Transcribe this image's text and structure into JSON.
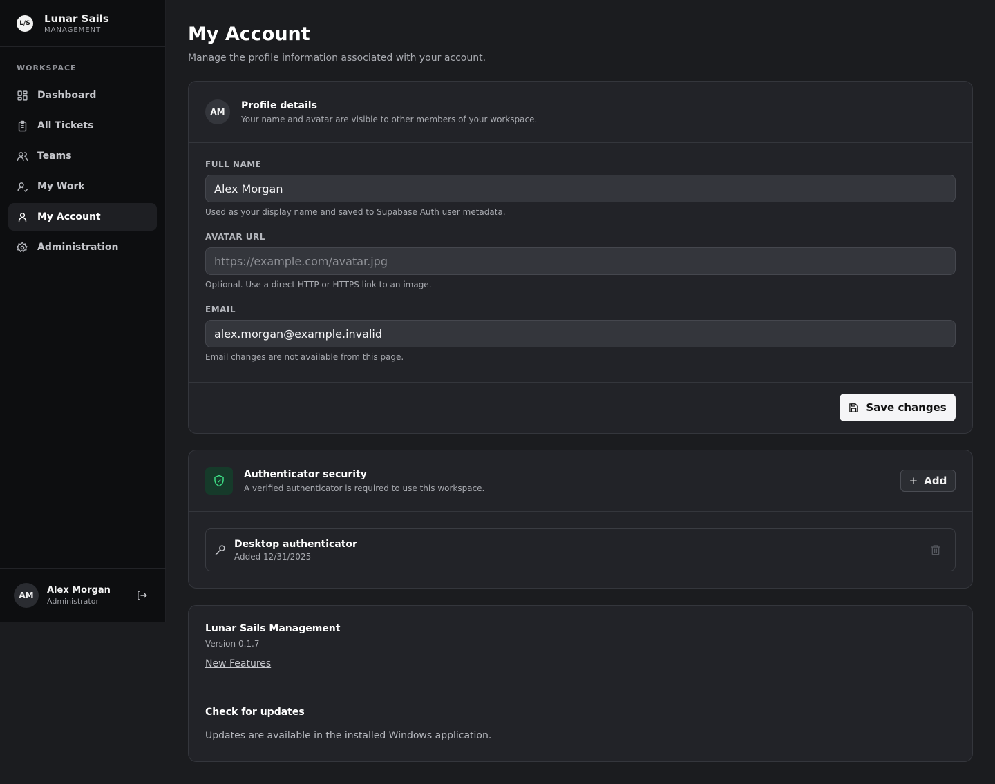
{
  "brand": {
    "logo": "L/S",
    "name": "Lunar Sails",
    "subtitle": "MANAGEMENT"
  },
  "sidebar": {
    "section_label": "WORKSPACE",
    "items": [
      {
        "label": "Dashboard",
        "icon": "grid-icon"
      },
      {
        "label": "All Tickets",
        "icon": "clipboard-icon"
      },
      {
        "label": "Teams",
        "icon": "users-icon"
      },
      {
        "label": "My Work",
        "icon": "user-check-icon"
      },
      {
        "label": "My Account",
        "icon": "user-icon",
        "active": true
      },
      {
        "label": "Administration",
        "icon": "gear-icon"
      }
    ],
    "user": {
      "initials": "AM",
      "name": "Alex Morgan",
      "role": "Administrator"
    }
  },
  "page": {
    "title": "My Account",
    "subtitle": "Manage the profile information associated with your account."
  },
  "profile": {
    "initials": "AM",
    "title": "Profile details",
    "description": "Your name and avatar are visible to other members of your workspace.",
    "full_name": {
      "label": "FULL NAME",
      "value": "Alex Morgan",
      "help": "Used as your display name and saved to Supabase Auth user metadata."
    },
    "avatar_url": {
      "label": "AVATAR URL",
      "value": "",
      "placeholder": "https://example.com/avatar.jpg",
      "help": "Optional. Use a direct HTTP or HTTPS link to an image."
    },
    "email": {
      "label": "EMAIL",
      "value": "alex.morgan@example.invalid",
      "help": "Email changes are not available from this page."
    },
    "save_label": "Save changes"
  },
  "security": {
    "title": "Authenticator security",
    "description": "A verified authenticator is required to use this workspace.",
    "add_label": "Add",
    "authenticators": [
      {
        "name": "Desktop authenticator",
        "added": "Added 12/31/2025"
      }
    ]
  },
  "app": {
    "name": "Lunar Sails Management",
    "version": "Version 0.1.7",
    "link": "New Features",
    "updates_title": "Check for updates",
    "updates_text": "Updates are available in the installed Windows application."
  },
  "colors": {
    "accent_green": "#3ddc84",
    "background": "#1b1c1f",
    "sidebar": "#0d0e10"
  }
}
